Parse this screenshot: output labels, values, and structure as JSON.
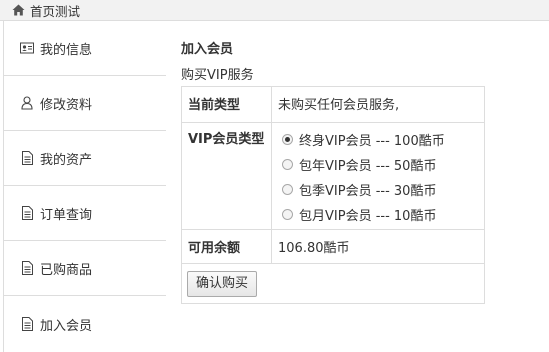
{
  "breadcrumb": {
    "label": "首页测试"
  },
  "sidebar": {
    "items": [
      {
        "label": "我的信息",
        "icon": "id-card-icon"
      },
      {
        "label": "修改资料",
        "icon": "user-icon"
      },
      {
        "label": "我的资产",
        "icon": "document-icon"
      },
      {
        "label": "订单查询",
        "icon": "document-icon"
      },
      {
        "label": "已购商品",
        "icon": "document-icon"
      },
      {
        "label": "加入会员",
        "icon": "document-icon",
        "active": true
      }
    ]
  },
  "main": {
    "title": "加入会员",
    "subtitle": "购买VIP服务",
    "rows": {
      "current_type_label": "当前类型",
      "current_type_value": "未购买任何会员服务,",
      "vip_type_label": "VIP会员类型",
      "vip_options": [
        {
          "label": "终身VIP会员 --- 100酷币",
          "checked": true
        },
        {
          "label": "包年VIP会员 --- 50酷币",
          "checked": false
        },
        {
          "label": "包季VIP会员 --- 30酷币",
          "checked": false
        },
        {
          "label": "包月VIP会员 --- 10酷币",
          "checked": false
        }
      ],
      "balance_label": "可用余额",
      "balance_value": "106.80酷币"
    },
    "confirm_button": "确认购买"
  }
}
